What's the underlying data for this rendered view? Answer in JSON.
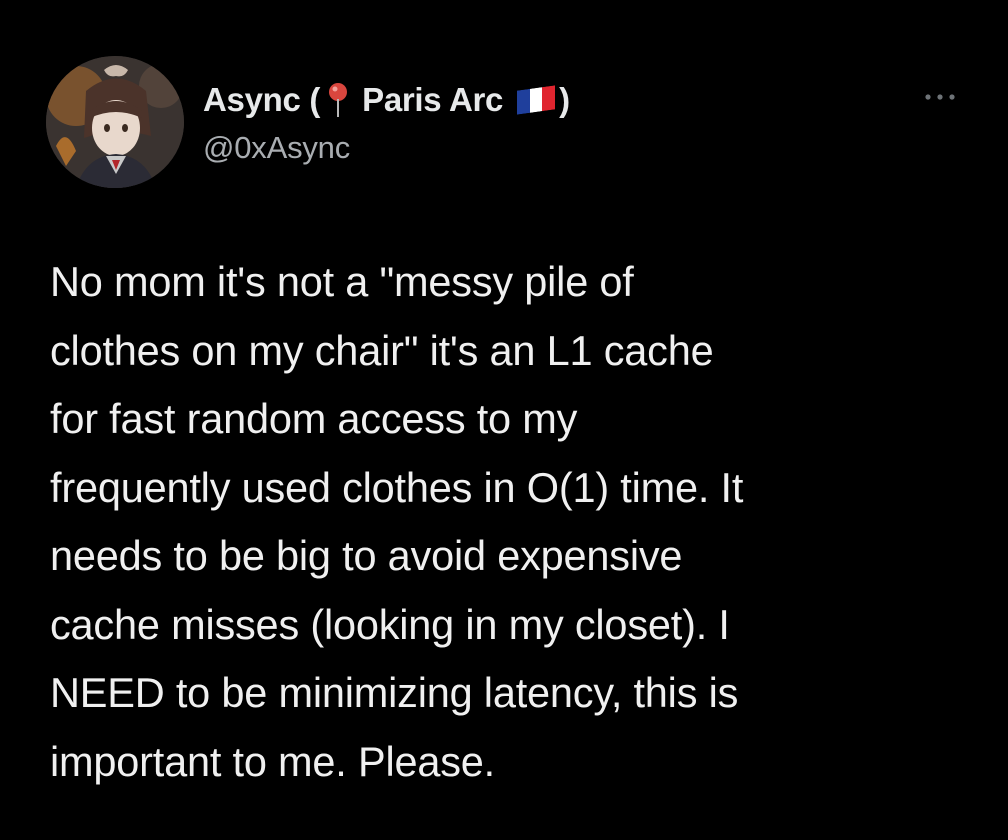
{
  "author": {
    "name_prefix": "Async (",
    "location": "Paris Arc",
    "name_suffix": ")",
    "handle": "@0xAsync",
    "location_icon": "round-pushpin-icon",
    "flag_icon": "france-flag-icon",
    "avatar_icon": "anime-avatar"
  },
  "menu": {
    "icon": "more-options-icon"
  },
  "tweet": {
    "lines": [
      "No mom it's not a \"messy pile of",
      "clothes on my chair\" it's an L1 cache",
      "for fast random access to my",
      "frequently used clothes in O(1) time. It",
      "needs to be big to avoid expensive",
      "cache misses (looking in my closet). I",
      "NEED to be minimizing latency, this is",
      "important to me. Please."
    ]
  },
  "colors": {
    "background": "#000000",
    "text": "#e7e9ea",
    "secondary_text": "#a9adb1",
    "pin_red": "#d9463e",
    "flag_blue": "#1f3f9c",
    "flag_white": "#ffffff",
    "flag_red": "#e0252f"
  }
}
